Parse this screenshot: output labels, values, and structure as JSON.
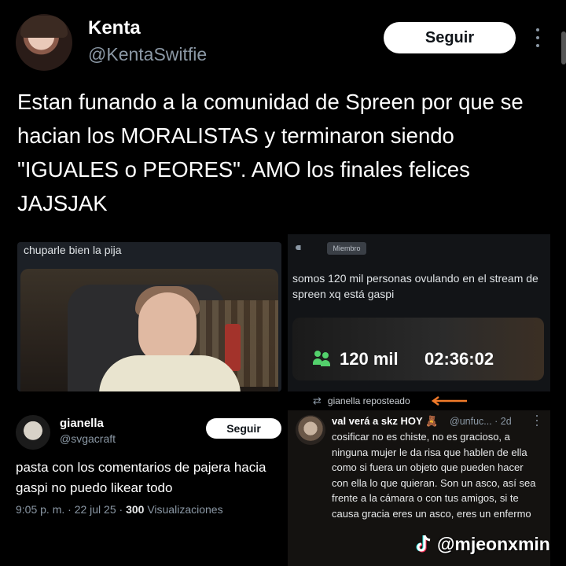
{
  "tweet": {
    "author_name": "Kenta",
    "author_handle": "@KentaSwitfie",
    "follow_label": "Seguir",
    "text": "Estan funando a la comunidad de Spreen por que se hacian los MORALISTAS y terminaron siendo \"IGUALES o PEORES\". AMO los finales felices JAJSJAK"
  },
  "embedded_left": {
    "caption": "chuparle bien la pija"
  },
  "embedded_right": {
    "member_badge": "Miembro",
    "text": "somos 120 mil personas ovulando en el stream de spreen xq está gaspi",
    "viewers": "120 mil",
    "duration": "02:36:02",
    "repost_label": "gianella reposteado"
  },
  "bottom_left": {
    "name": "gianella",
    "handle": "@svgacraft",
    "follow_label": "Seguir",
    "text": "pasta con los comentarios de pajera hacia gaspi no puedo likear todo",
    "meta_time": "9:05 p. m. · 22 jul 25 · ",
    "meta_views_count": "300",
    "meta_views_label": " Visualizaciones"
  },
  "bottom_right": {
    "name": "val verá a skz HOY 🧸",
    "handle": "@unfuc... · 2d",
    "text": "cosificar no es chiste, no es gracioso, a ninguna mujer le da risa que hablen de ella como si fuera un objeto que pueden hacer con ella lo que quieran. Son un asco, así sea frente a la cámara o con tus amigos, si te causa gracia eres un asco, eres un enfermo"
  },
  "watermark": {
    "handle": "@mjeonxmin",
    "icon": "tiktok-icon"
  },
  "colors": {
    "background": "#000000",
    "handle_gray": "#8b98a5",
    "viewer_green": "#53d16c",
    "arrow_orange": "#f07a2a"
  }
}
